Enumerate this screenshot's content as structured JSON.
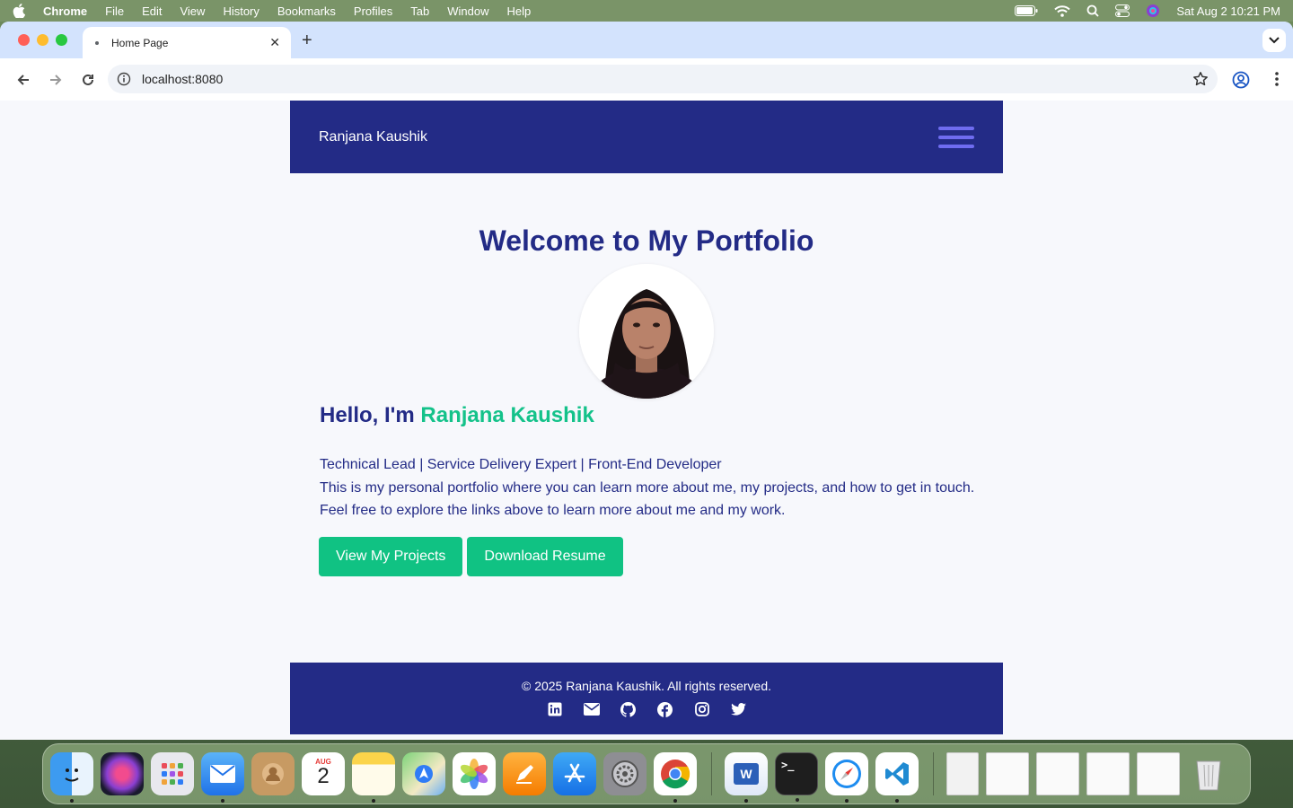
{
  "menubar": {
    "app": "Chrome",
    "items": [
      "File",
      "Edit",
      "View",
      "History",
      "Bookmarks",
      "Profiles",
      "Tab",
      "Window",
      "Help"
    ],
    "clock": "Sat Aug 2  10:21 PM"
  },
  "browser": {
    "tab_title": "Home Page",
    "url": "localhost:8080"
  },
  "site": {
    "brand": "Ranjana Kaushik",
    "hero_title": "Welcome to My Portfolio",
    "hello_prefix": "Hello, I'm ",
    "hello_name": "Ranjana Kaushik",
    "tagline": "Technical Lead | Service Delivery Expert | Front-End Developer",
    "intro_line1": "This is my personal portfolio where you can learn more about me, my projects, and how to get in touch.",
    "intro_line2": "Feel free to explore the links above to learn more about me and my work.",
    "btn_projects": "View My Projects",
    "btn_resume": "Download Resume",
    "footer_copy": "© 2025 Ranjana Kaushik. All rights reserved.",
    "social": [
      "linkedin-icon",
      "mail-icon",
      "github-icon",
      "facebook-icon",
      "instagram-icon",
      "twitter-icon"
    ]
  },
  "colors": {
    "navy": "#232b86",
    "accent": "#10c283",
    "hamburger": "#6f6cf0"
  },
  "dock": {
    "calendar_month": "AUG",
    "calendar_day": "2"
  }
}
